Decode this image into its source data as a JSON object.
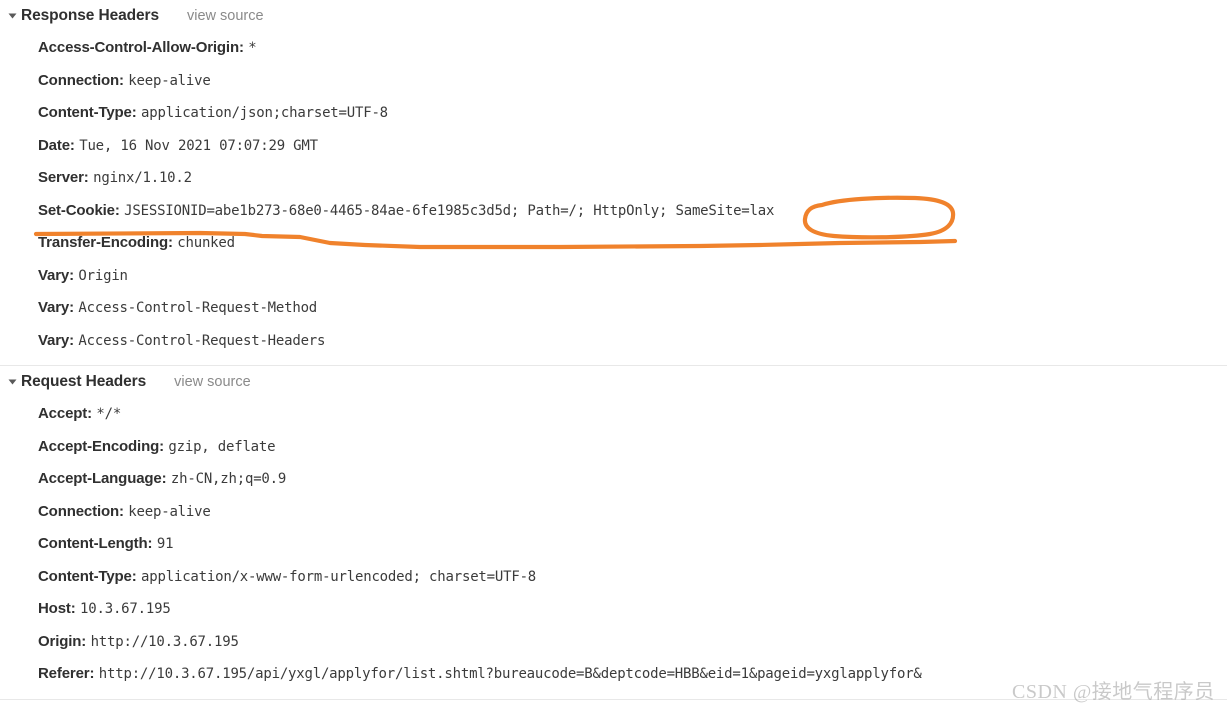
{
  "panel": {
    "name": "network-headers-panel",
    "view_source_label": "view source",
    "annotation_color": "#f0822c",
    "divider_color": "#e8e8e8"
  },
  "sections": [
    {
      "id": "response-headers",
      "title": "Response Headers",
      "view_source_label": "view source",
      "rows": [
        {
          "name": "Access-Control-Allow-Origin:",
          "value": "*"
        },
        {
          "name": "Connection:",
          "value": "keep-alive"
        },
        {
          "name": "Content-Type:",
          "value": "application/json;charset=UTF-8"
        },
        {
          "name": "Date:",
          "value": "Tue, 16 Nov 2021 07:07:29 GMT"
        },
        {
          "name": "Server:",
          "value": "nginx/1.10.2"
        },
        {
          "name": "Set-Cookie:",
          "value": "JSESSIONID=abe1b273-68e0-4465-84ae-6fe1985c3d5d; Path=/; HttpOnly; SameSite=lax"
        },
        {
          "name": "Transfer-Encoding:",
          "value": "chunked"
        },
        {
          "name": "Vary:",
          "value": "Origin"
        },
        {
          "name": "Vary:",
          "value": "Access-Control-Request-Method"
        },
        {
          "name": "Vary:",
          "value": "Access-Control-Request-Headers"
        }
      ]
    },
    {
      "id": "request-headers",
      "title": "Request Headers",
      "view_source_label": "view source",
      "rows": [
        {
          "name": "Accept:",
          "value": "*/*"
        },
        {
          "name": "Accept-Encoding:",
          "value": "gzip, deflate"
        },
        {
          "name": "Accept-Language:",
          "value": "zh-CN,zh;q=0.9"
        },
        {
          "name": "Connection:",
          "value": "keep-alive"
        },
        {
          "name": "Content-Length:",
          "value": "91"
        },
        {
          "name": "Content-Type:",
          "value": "application/x-www-form-urlencoded; charset=UTF-8"
        },
        {
          "name": "Host:",
          "value": "10.3.67.195"
        },
        {
          "name": "Origin:",
          "value": "http://10.3.67.195"
        },
        {
          "name": "Referer:",
          "value": "http://10.3.67.195/api/yxgl/applyfor/list.shtml?bureaucode=B&deptcode=HBB&eid=1&pageid=yxglapplyfor&"
        }
      ]
    }
  ],
  "annotations": {
    "circled_text": "SameSite=lax",
    "underlined_row": "Set-Cookie:",
    "color": "#f0822c"
  },
  "watermark": {
    "text": "CSDN @接地气程序员"
  }
}
